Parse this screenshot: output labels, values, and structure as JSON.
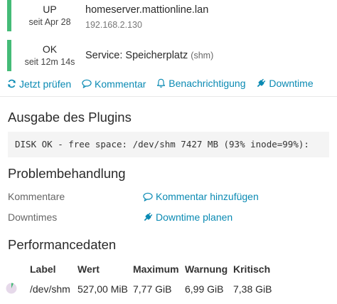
{
  "host": {
    "state": "UP",
    "since": "seit Apr 28",
    "name": "homeserver.mattionline.lan",
    "address": "192.168.2.130"
  },
  "service": {
    "state": "OK",
    "since": "seit 12m 14s",
    "name": "Service: Speicherplatz",
    "host_suffix": "(shm)"
  },
  "state_color": "#44bb77",
  "link_color": "#0a8ab3",
  "actions": [
    {
      "label": "Jetzt prüfen",
      "icon": "refresh-icon"
    },
    {
      "label": "Kommentar",
      "icon": "comment-icon"
    },
    {
      "label": "Benachrichtigung",
      "icon": "bell-icon"
    },
    {
      "label": "Downtime",
      "icon": "plug-icon"
    }
  ],
  "plugin_output": {
    "heading": "Ausgabe des Plugins",
    "text": "DISK OK - free space: /dev/shm 7427 MB (93% inode=99%):"
  },
  "problem_handling": {
    "heading": "Problembehandlung",
    "comments_label": "Kommentare",
    "comments_link": "Kommentar hinzufügen",
    "downtimes_label": "Downtimes",
    "downtimes_link": "Downtime planen"
  },
  "performance": {
    "heading": "Performancedaten",
    "columns": [
      "Label",
      "Wert",
      "Maximum",
      "Warnung",
      "Kritisch"
    ],
    "rows": [
      {
        "label": "/dev/shm",
        "value": "527,00 MiB",
        "maximum": "7,77 GiB",
        "warning": "6,99 GiB",
        "critical": "7,38 GiB",
        "usage_fraction": 0.066
      }
    ]
  }
}
